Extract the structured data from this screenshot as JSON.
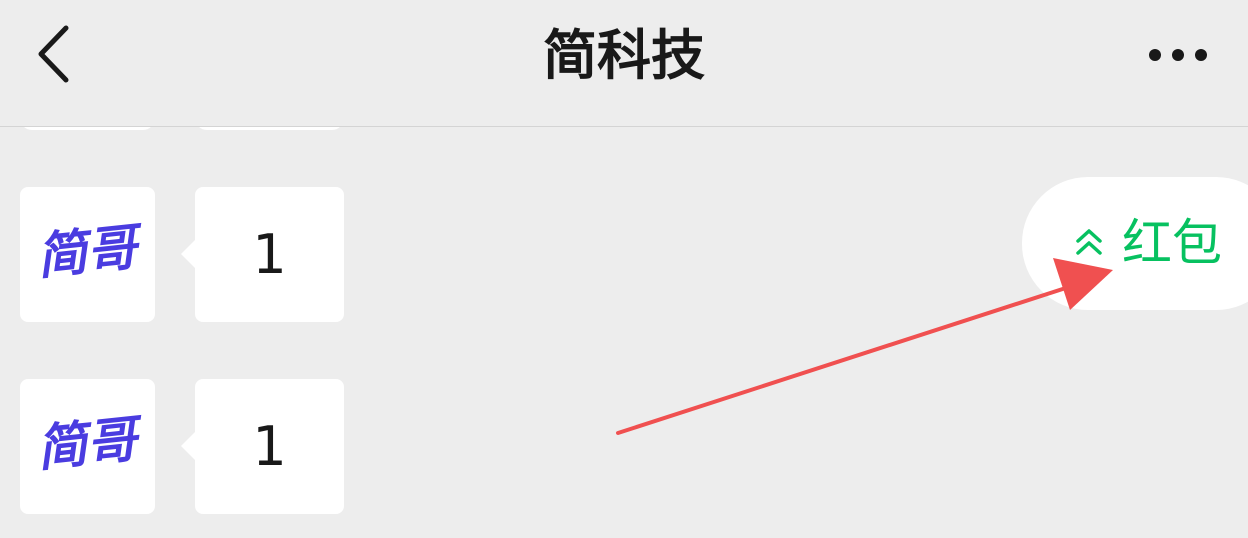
{
  "header": {
    "title": "简科技",
    "back_icon": "chevron-left-icon",
    "more_icon": "more-dots-icon"
  },
  "messages": [
    {
      "avatar_text": "简哥",
      "text": "1"
    },
    {
      "avatar_text": "简哥",
      "text": "1"
    }
  ],
  "red_packet": {
    "label": "红包",
    "icon": "double-chevron-up-icon",
    "color": "#07c160"
  },
  "annotation": {
    "arrow_color": "#f05050"
  },
  "colors": {
    "background": "#ededed",
    "avatar_text": "#4a3ce0"
  }
}
